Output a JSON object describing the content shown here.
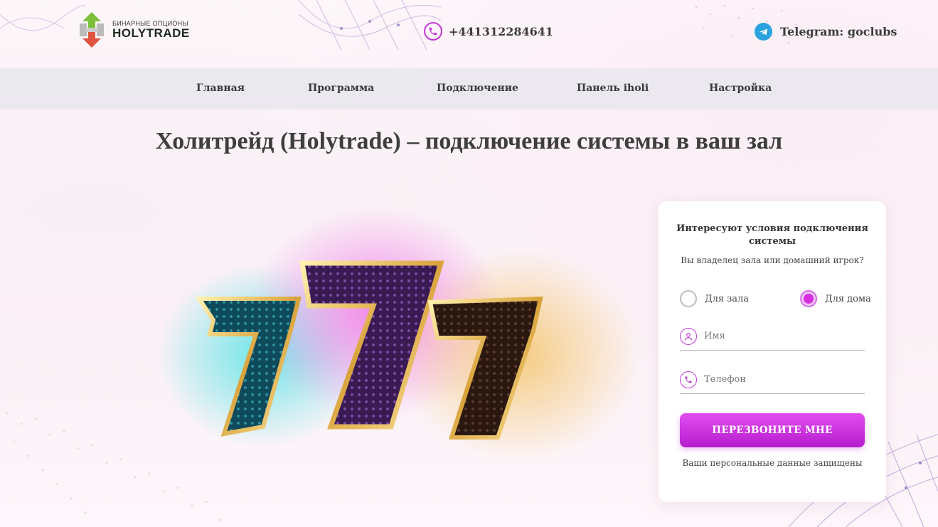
{
  "header": {
    "logo_sub": "БИНАРНЫЕ ОПЦИОНЫ",
    "logo_main": "HOLYTRADE",
    "phone": "+441312284641",
    "telegram": "Telegram: goclubs"
  },
  "nav": {
    "items": [
      "Главная",
      "Программа",
      "Подключение",
      "Панель iholi",
      "Настройка"
    ]
  },
  "main": {
    "title": "Холитрейд (Holytrade) – подключение системы в ваш зал"
  },
  "form": {
    "title": "Интересуют условия подключения системы",
    "question": "Вы владелец зала или домашний игрок?",
    "radio_hall": "Для зала",
    "radio_home": "Для дома",
    "selected": "home",
    "name_placeholder": "Имя",
    "phone_placeholder": "Телефон",
    "submit": "ПЕРЕЗВОНИТЕ МНЕ",
    "note": "Ваши персональные данные защищены"
  },
  "colors": {
    "accent": "#c13ad6",
    "button": "#d23ae4",
    "telegram": "#2aa3df",
    "nav_bg": "#e9e8ee"
  },
  "icons": [
    "logo-icon",
    "phone-icon",
    "telegram-icon",
    "user-icon",
    "phone-icon"
  ]
}
